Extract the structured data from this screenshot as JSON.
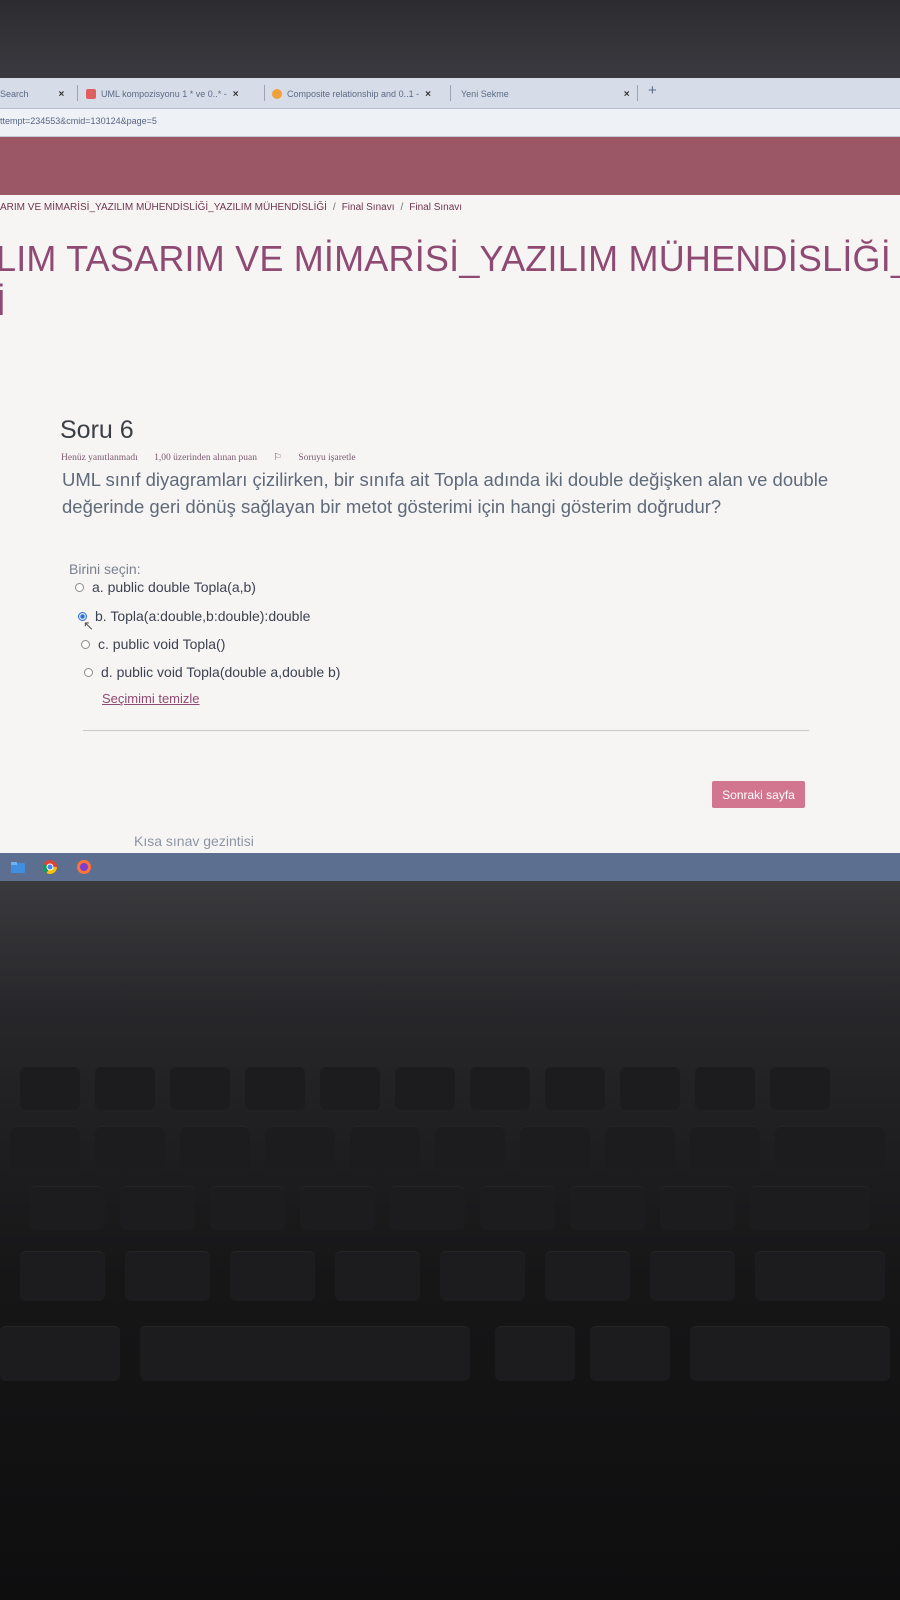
{
  "browser": {
    "tabs": [
      {
        "label": "Search",
        "close": "×"
      },
      {
        "label": "UML kompozisyonu 1 * ve 0..* -",
        "close": "×"
      },
      {
        "label": "Composite relationship and 0..1 -",
        "close": "×"
      },
      {
        "label": "Yeni Sekme",
        "close": "×"
      }
    ],
    "new_tab": "+",
    "url": "ttempt=234553&cmid=130124&page=5"
  },
  "breadcrumb": {
    "items": [
      "ARIM VE MİMARİSİ_YAZILIM MÜHENDİSLİĞİ_YAZILIM MÜHENDİSLİĞİ",
      "Final Sınavı",
      "Final Sınavı"
    ],
    "separator": "/"
  },
  "course": {
    "title_line1": "LIM TASARIM VE MİMARİSİ_YAZILIM MÜHENDİSLİĞİ_YAZIL",
    "title_line2": "İ"
  },
  "question": {
    "number": "Soru 6",
    "status": "Henüz yanıtlanmadı",
    "points": "1,00 üzerinden alınan puan",
    "flag": "Soruyu işaretle",
    "text": "UML sınıf diyagramları çizilirken, bir sınıfa ait Topla adında iki double değişken alan ve double değerinde geri dönüş sağlayan bir metot gösterimi için hangi gösterim doğrudur?",
    "prompt": "Birini seçin:",
    "options": [
      {
        "label": "a. public double Topla(a,b)",
        "selected": false
      },
      {
        "label": "b. Topla(a:double,b:double):double",
        "selected": true
      },
      {
        "label": "c. public void Topla()",
        "selected": false
      },
      {
        "label": "d. public void Topla(double a,double b)",
        "selected": false
      }
    ],
    "clear_label": "Seçimimi temizle"
  },
  "navigation": {
    "next_label": "Sonraki sayfa",
    "quiz_nav_label": "Kısa sınav gezintisi"
  },
  "colors": {
    "accent": "#8f4a73",
    "banner": "#9b5766",
    "button": "#d2768f",
    "taskbar": "#5d6f90"
  },
  "taskbar": {
    "icons": [
      "folder-icon",
      "chrome-icon",
      "firefox-icon"
    ]
  }
}
